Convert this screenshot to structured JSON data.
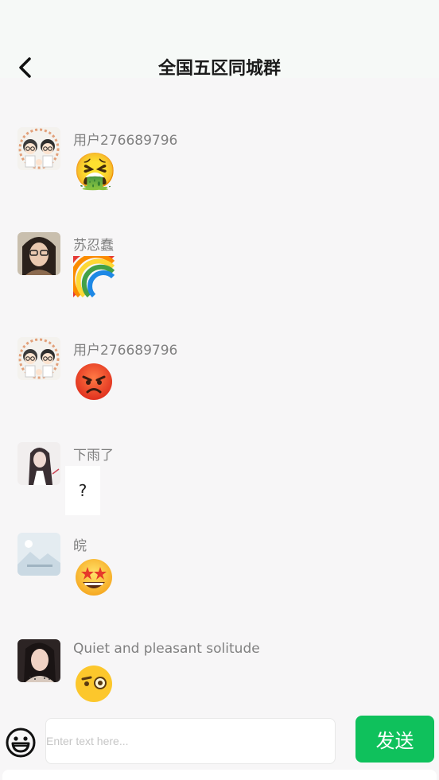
{
  "header": {
    "title": "全国五区同城群"
  },
  "messages": [
    {
      "user": "用户276689796",
      "emoji": "🤮",
      "avatar_icon": "couple-cartoon-avatar"
    },
    {
      "user": "苏忍蠢",
      "emoji": "🌈",
      "avatar_icon": "woman-glasses-avatar"
    },
    {
      "user": "用户276689796",
      "emoji": "😡",
      "avatar_icon": "couple-cartoon-avatar"
    },
    {
      "user": "下雨了",
      "text": "?",
      "avatar_icon": "long-hair-girl-avatar"
    },
    {
      "user": "皖",
      "emoji": "🤩",
      "avatar_icon": "placeholder-image-avatar"
    },
    {
      "user": "Quiet and pleasant solitude",
      "emoji": "🧐",
      "avatar_icon": "woman-portrait-avatar"
    }
  ],
  "composer": {
    "placeholder": "Enter text here...",
    "value": "",
    "send_label": "发送"
  },
  "colors": {
    "accent": "#0fc15c",
    "background": "#f7f6f7",
    "name_text": "#808080"
  }
}
